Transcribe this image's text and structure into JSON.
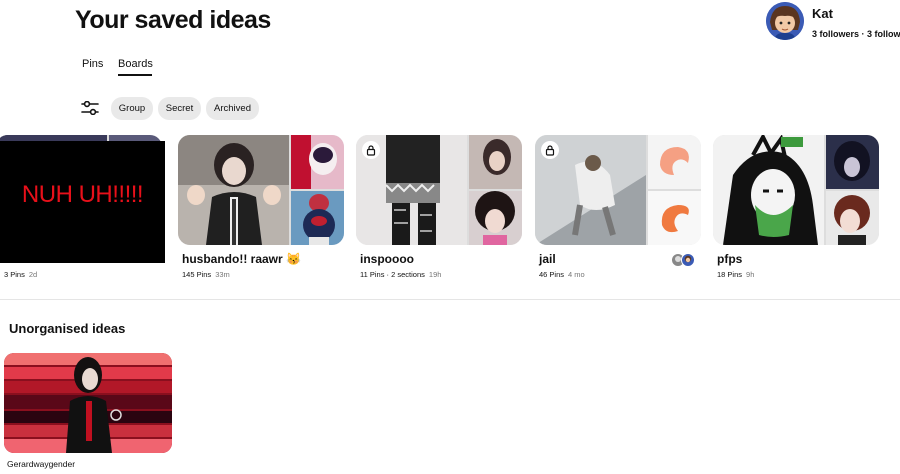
{
  "page": {
    "title": "Your saved ideas"
  },
  "profile": {
    "name": "Kat",
    "stats": "3 followers · 3 follow"
  },
  "tabs": [
    {
      "label": "Pins"
    },
    {
      "label": "Boards"
    }
  ],
  "filters": [
    {
      "label": "Group"
    },
    {
      "label": "Secret"
    },
    {
      "label": "Archived"
    }
  ],
  "boards": [
    {
      "title": "",
      "pins": "3 Pins",
      "ago": "2d",
      "overlay_text": "NUH UH!!!!!"
    },
    {
      "title": "husbando!! raawr 😽",
      "pins": "145 Pins",
      "ago": "33m"
    },
    {
      "title": "inspoooo",
      "pins": "11 Pins · 2 sections",
      "ago": "19h",
      "secret": true
    },
    {
      "title": "jail",
      "pins": "46 Pins",
      "ago": "4 mo",
      "secret": true
    },
    {
      "title": "pfps",
      "pins": "18 Pins",
      "ago": "9h"
    }
  ],
  "unorganised": {
    "title": "Unorganised ideas",
    "items": [
      {
        "label": "Gerardwaygender"
      }
    ]
  },
  "colors": {
    "accent_red": "#e8101a",
    "chip_bg": "#e9e9e9",
    "text": "#111111",
    "muted": "#767676"
  }
}
